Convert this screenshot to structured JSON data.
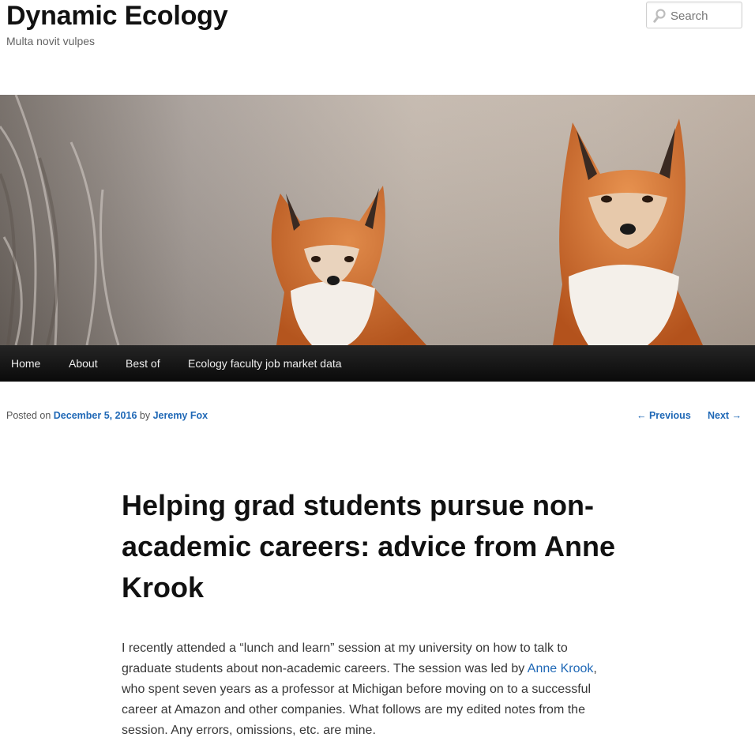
{
  "site": {
    "title": "Dynamic Ecology",
    "tagline": "Multa novit vulpes"
  },
  "search": {
    "placeholder": "Search",
    "icon": "search-icon"
  },
  "banner": {
    "subject": "two red foxes"
  },
  "nav": {
    "items": [
      {
        "label": "Home"
      },
      {
        "label": "About"
      },
      {
        "label": "Best of"
      },
      {
        "label": "Ecology faculty job market data"
      }
    ]
  },
  "meta": {
    "posted_on": "Posted on",
    "date": "December 5, 2016",
    "by": "by",
    "author": "Jeremy Fox"
  },
  "post_nav": {
    "previous": "← Previous",
    "next": "Next →"
  },
  "post": {
    "title": "Helping grad students pursue non-academic careers: advice from Anne Krook",
    "body_before_link": "I recently attended a “lunch and learn” session at my university on how to talk to graduate students about non-academic careers. The session was led by ",
    "link_text": "Anne Krook",
    "body_after_link": ", who spent seven years as a professor at Michigan before moving on to a successful career at Amazon and other companies. What follows are my edited notes from the session. Any errors, omissions, etc. are mine."
  },
  "colors": {
    "link": "#1f68b6",
    "nav_bg": "#111111",
    "text": "#373737"
  }
}
